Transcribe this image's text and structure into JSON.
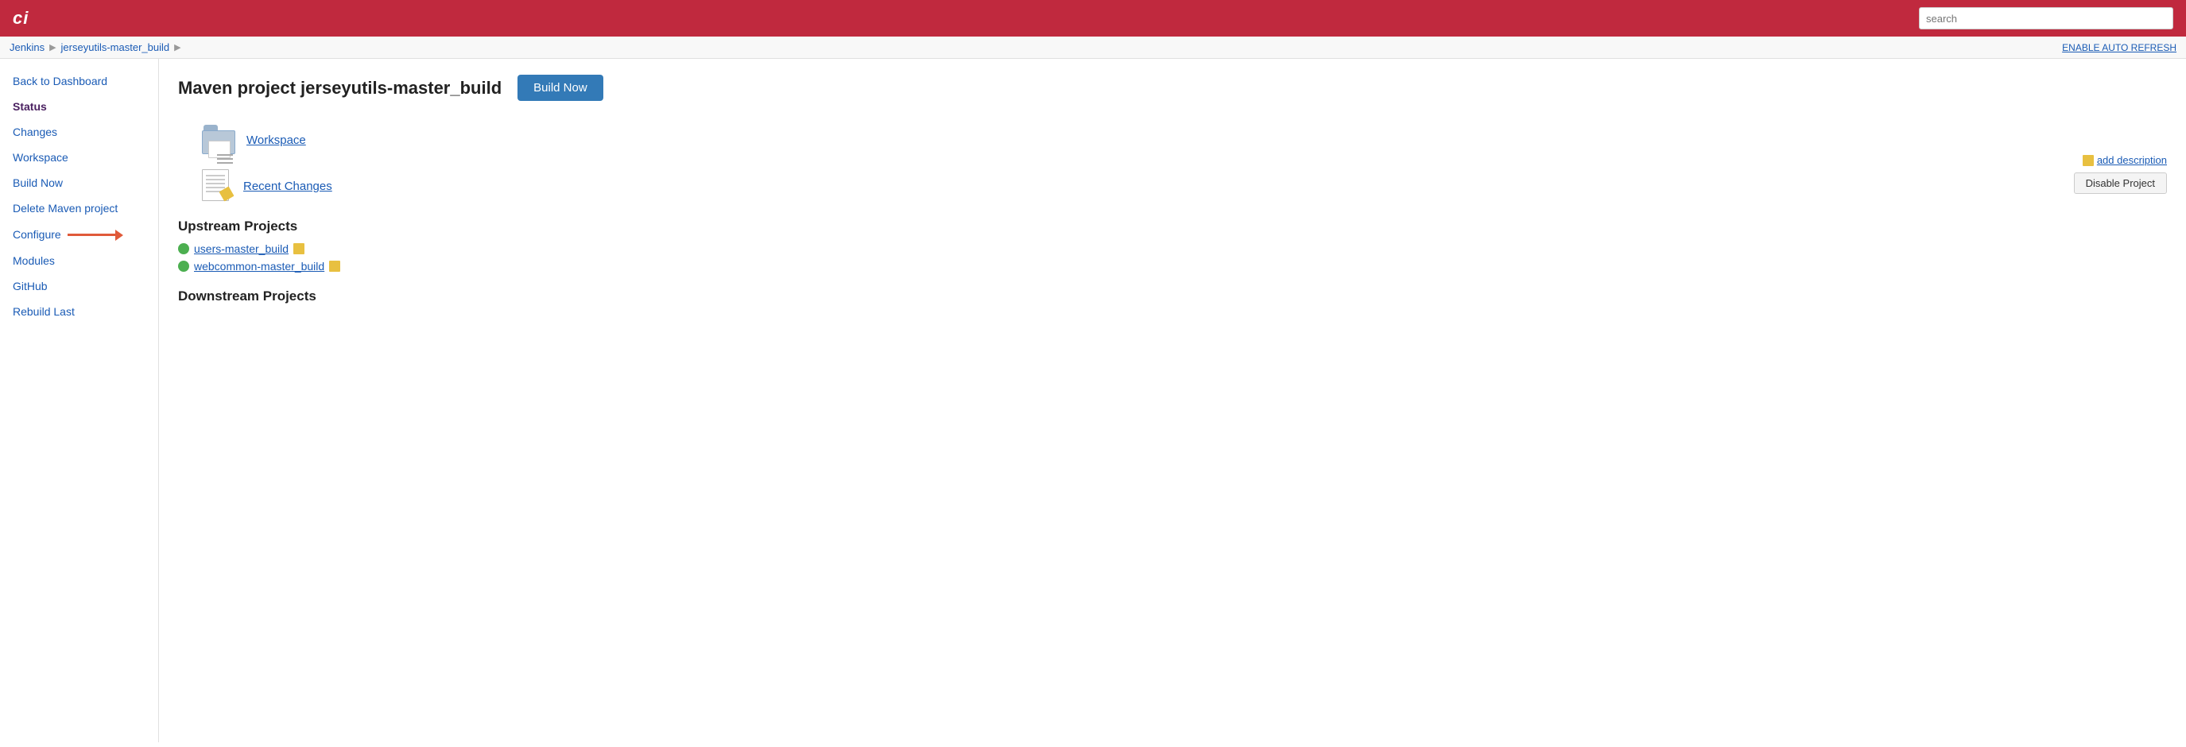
{
  "header": {
    "logo": "ci",
    "search_placeholder": "search"
  },
  "breadcrumb": {
    "items": [
      "Jenkins",
      "jerseyutils-master_build"
    ],
    "enable_auto_refresh": "ENABLE AUTO REFRESH"
  },
  "sidebar": {
    "back_label": "Back to Dashboard",
    "status_label": "Status",
    "items": [
      {
        "id": "changes",
        "label": "Changes"
      },
      {
        "id": "workspace",
        "label": "Workspace"
      },
      {
        "id": "build-now",
        "label": "Build Now"
      },
      {
        "id": "delete-maven",
        "label": "Delete Maven project"
      },
      {
        "id": "configure",
        "label": "Configure"
      },
      {
        "id": "modules",
        "label": "Modules"
      },
      {
        "id": "github",
        "label": "GitHub"
      },
      {
        "id": "rebuild-last",
        "label": "Rebuild Last"
      }
    ]
  },
  "main": {
    "page_title": "Maven project jerseyutils-master_build",
    "build_now_button": "Build Now",
    "add_description_link": "add description",
    "disable_project_button": "Disable Project",
    "workspace_link": "Workspace",
    "recent_changes_link": "Recent Changes",
    "upstream_projects_title": "Upstream Projects",
    "upstream_projects": [
      {
        "name": "users-master_build",
        "status": "green"
      },
      {
        "name": "webcommon-master_build",
        "status": "green"
      }
    ],
    "downstream_projects_title": "Downstream Projects"
  }
}
